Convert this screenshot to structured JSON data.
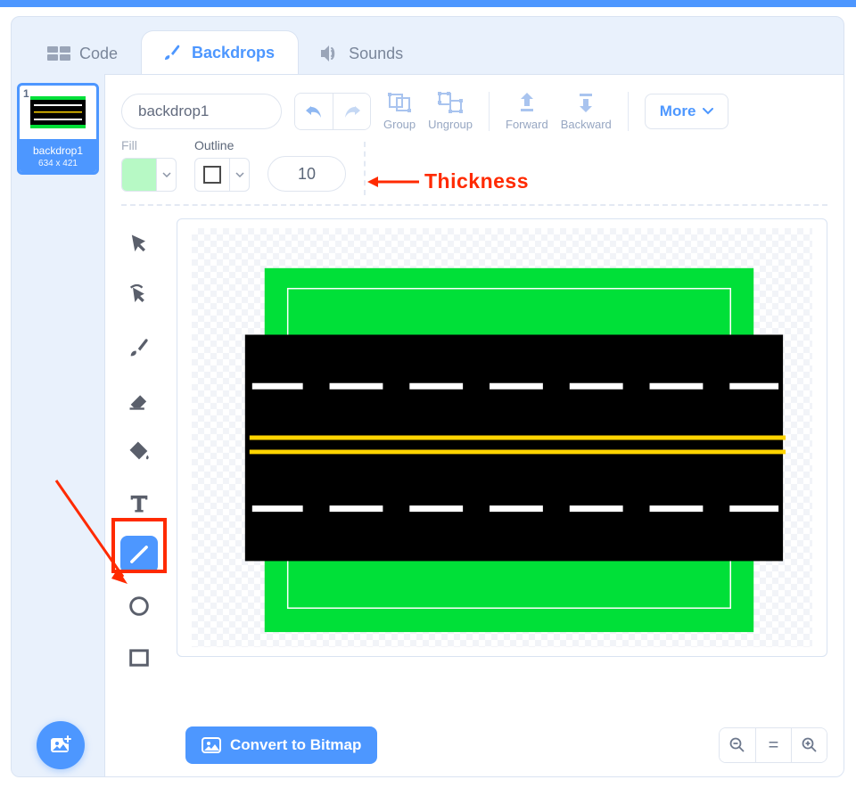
{
  "tabs": {
    "code": "Code",
    "backdrops": "Backdrops",
    "sounds": "Sounds"
  },
  "sidebar": {
    "thumb_index": "1",
    "thumb_name": "backdrop1",
    "thumb_dims": "634 x 421"
  },
  "toolbar": {
    "costume_name": "backdrop1",
    "group": "Group",
    "ungroup": "Ungroup",
    "forward": "Forward",
    "backward": "Backward",
    "more": "More"
  },
  "row2": {
    "fill_label": "Fill",
    "fill_color": "#b7f9c5",
    "outline_label": "Outline",
    "thickness_value": "10"
  },
  "annotation": {
    "thickness": "Thickness"
  },
  "bottom": {
    "convert": "Convert to Bitmap",
    "eq": "="
  }
}
